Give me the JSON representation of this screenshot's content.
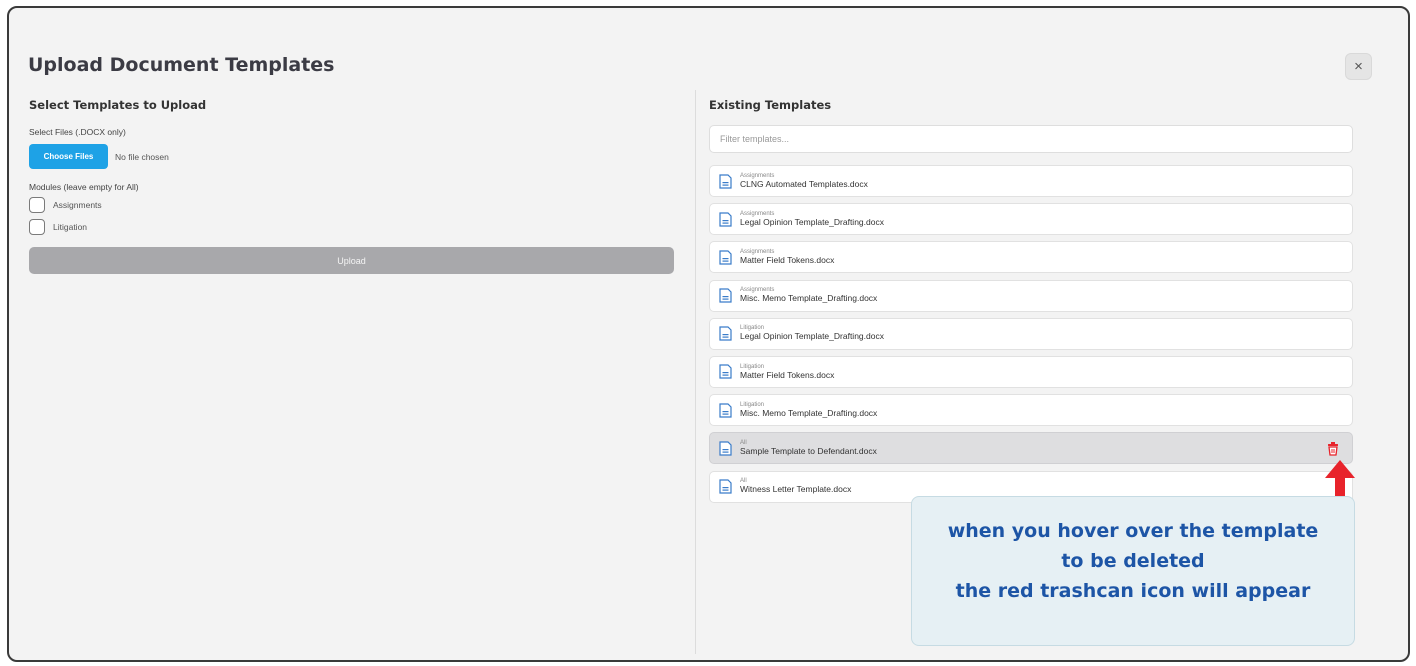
{
  "dialog": {
    "title": "Upload Document Templates",
    "close_glyph": "×"
  },
  "upload_panel": {
    "heading": "Select Templates to Upload",
    "files_label": "Select Files (.DOCX only)",
    "choose_button": "Choose Files",
    "no_file_text": "No file chosen",
    "modules_label": "Modules (leave empty for All)",
    "modules": [
      {
        "label": "Assignments",
        "checked": false
      },
      {
        "label": "Litigation",
        "checked": false
      }
    ],
    "upload_button": "Upload"
  },
  "existing_panel": {
    "heading": "Existing Templates",
    "filter_placeholder": "Filter templates...",
    "templates": [
      {
        "module": "Assignments",
        "name": "CLNG Automated Templates.docx"
      },
      {
        "module": "Assignments",
        "name": "Legal Opinion Template_Drafting.docx"
      },
      {
        "module": "Assignments",
        "name": "Matter Field Tokens.docx"
      },
      {
        "module": "Assignments",
        "name": "Misc. Memo Template_Drafting.docx"
      },
      {
        "module": "Litigation",
        "name": "Legal Opinion Template_Drafting.docx"
      },
      {
        "module": "Litigation",
        "name": "Matter Field Tokens.docx"
      },
      {
        "module": "Litigation",
        "name": "Misc. Memo Template_Drafting.docx"
      },
      {
        "module": "All",
        "name": "Sample Template to Defendant.docx",
        "hovered": true
      },
      {
        "module": "All",
        "name": "Witness Letter Template.docx"
      }
    ]
  },
  "annotation": {
    "lines": [
      "when you hover over the template",
      "to be deleted",
      "the red trashcan icon will appear"
    ]
  },
  "icons": {
    "close": "close-icon",
    "document": "document-icon",
    "trash": "trash-icon",
    "arrow": "arrow-up-icon"
  },
  "colors": {
    "accent": "#1ea2e6",
    "danger": "#e8232b",
    "annotation_text": "#1d55a6"
  }
}
